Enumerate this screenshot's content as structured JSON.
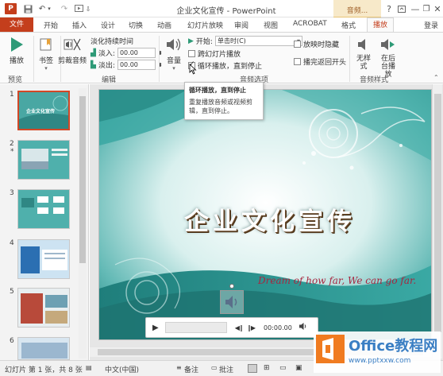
{
  "window": {
    "app_logo": "P",
    "title": "企业文化宣传 - PowerPoint",
    "context_group": "音频...",
    "help": "?",
    "min": "—",
    "max": "❐",
    "close": "✕"
  },
  "tabs": [
    {
      "label": "文件"
    },
    {
      "label": "开始"
    },
    {
      "label": "插入"
    },
    {
      "label": "设计"
    },
    {
      "label": "切换"
    },
    {
      "label": "动画"
    },
    {
      "label": "幻灯片放映"
    },
    {
      "label": "审阅"
    },
    {
      "label": "视图"
    },
    {
      "label": "ACROBAT"
    },
    {
      "label": "格式"
    },
    {
      "label": "播放"
    }
  ],
  "login": "登录",
  "ribbon": {
    "preview": {
      "play": "播放",
      "group": "预览"
    },
    "bookmarks": {
      "bookmark": "书签"
    },
    "editing": {
      "trim": "剪裁音频",
      "fade_label": "淡化持续时间",
      "fade_in": "淡入:",
      "fade_in_value": "00.00",
      "fade_out": "淡出:",
      "fade_out_value": "00.00",
      "group": "编辑"
    },
    "audio_options": {
      "volume": "音量",
      "start_label": "开始:",
      "start_value": "单击时(C)",
      "play_across": "跨幻灯片播放",
      "loop": "循环播放，直到停止",
      "hide": "放映时隐藏",
      "rewind": "播完返回开头",
      "group": "音频选项"
    },
    "audio_styles": {
      "no_style": "无样式",
      "bg_play": "在后台播放",
      "group": "音频样式"
    }
  },
  "tooltip": {
    "title": "循环播放，直到停止",
    "body": "重复播放音频或视频剪辑，直到停止。"
  },
  "thumbnails": [
    {
      "num": "1",
      "title": "企业文化宣传",
      "selected": true
    },
    {
      "num": "2",
      "star": "*"
    },
    {
      "num": "3"
    },
    {
      "num": "4"
    },
    {
      "num": "5"
    },
    {
      "num": "6"
    }
  ],
  "slide": {
    "title": "企业文化宣传",
    "subtitle": "Dream of how far, We can go far.",
    "media_time": "00:00.00"
  },
  "status": {
    "slide_info": "幻灯片 第 1 张，共 8 张",
    "lang": "中文(中国)",
    "notes": "备注",
    "comments": "批注"
  },
  "watermark": {
    "name": "Office教程网",
    "url": "www.pptxxw.com"
  },
  "colors": {
    "accent": "#c43e1c",
    "slide_bg": "#3e9e9c"
  }
}
